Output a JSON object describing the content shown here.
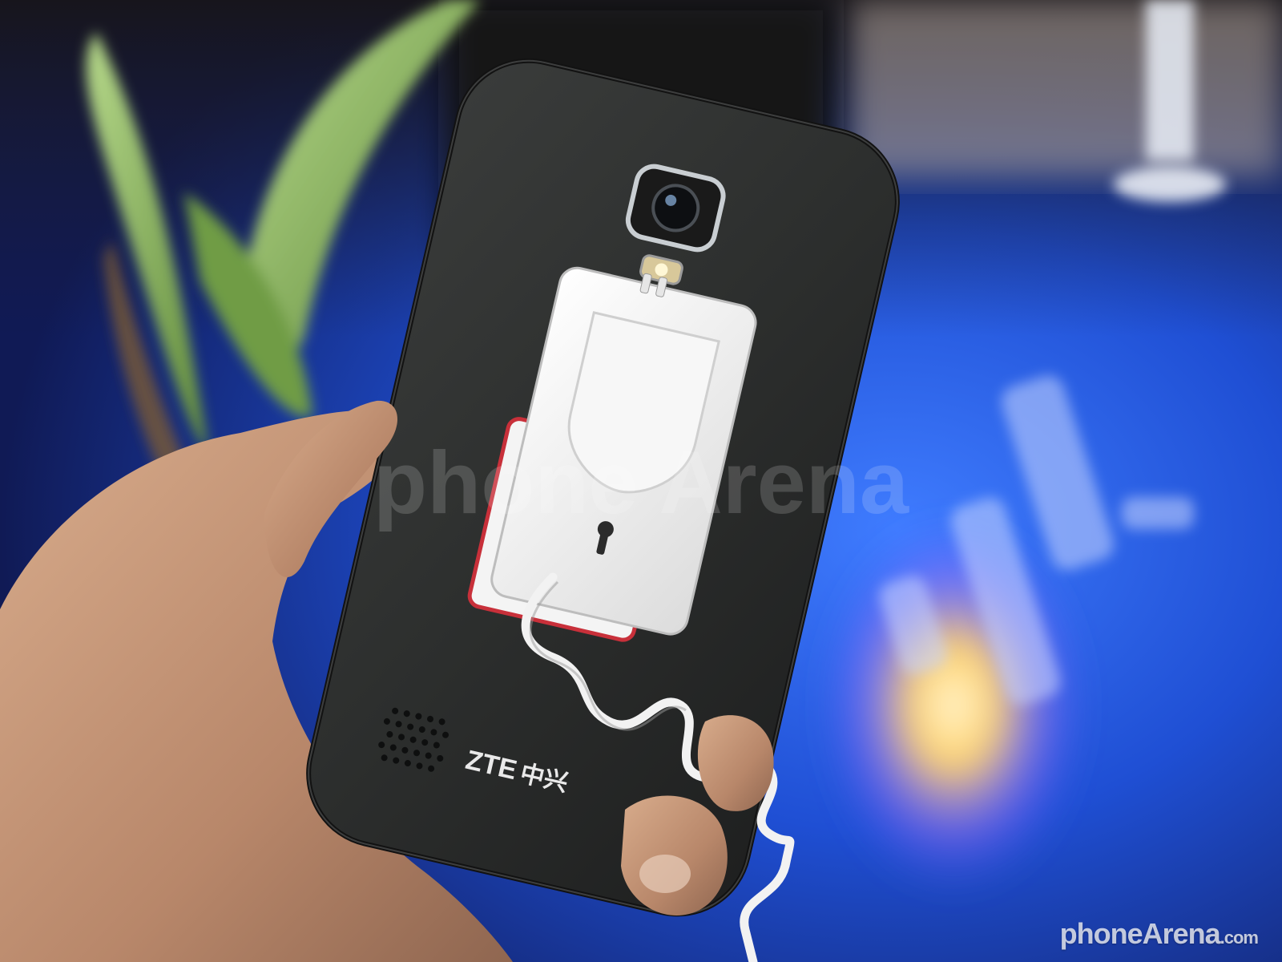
{
  "photo": {
    "subject": "ZTE phone rear view with anti-theft security tag",
    "phone_logo_latin": "ZTE",
    "phone_logo_cjk": "中兴",
    "watermark_center": "phone Arena",
    "watermark_corner_main": "phoneArena",
    "watermark_corner_domain": ".com"
  },
  "colors": {
    "phone_body": "#2b2d2c",
    "backdrop_blue": "#1d4fd0",
    "leaf_green": "#8fbf5a",
    "skin": "#c79a7a",
    "tag_white": "#f1f1ef",
    "tag_red": "#c8303a"
  }
}
